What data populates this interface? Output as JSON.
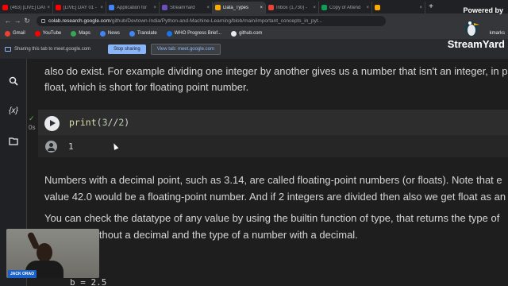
{
  "browser": {
    "tabs": [
      {
        "title": "(463) [LIVE] DAY",
        "color": "#ff0000",
        "active": false
      },
      {
        "title": "[LIVE] DAY 01 -",
        "color": "#ff0000",
        "active": false
      },
      {
        "title": "Application for",
        "color": "#4285f4",
        "active": false
      },
      {
        "title": "StreamYard",
        "color": "#6b4fbb",
        "active": false
      },
      {
        "title": "Data_Types",
        "color": "#f9ab00",
        "active": true
      },
      {
        "title": "Inbox (1,730) -",
        "color": "#ea4335",
        "active": false
      },
      {
        "title": "Copy of Attend",
        "color": "#0f9d58",
        "active": false
      },
      {
        "title": "",
        "color": "#f9ab00",
        "active": false
      }
    ],
    "new_tab": "+",
    "address": {
      "host": "colab.research.google.com",
      "path": "/github/Devtown-India/Python-and-Machine-Learning/blob/main/important_concepts_in_pyt..."
    },
    "bookmarks": [
      {
        "label": "Gmail",
        "color": "#ea4335"
      },
      {
        "label": "YouTube",
        "color": "#ff0000"
      },
      {
        "label": "Maps",
        "color": "#34a853"
      },
      {
        "label": "News",
        "color": "#4285f4"
      },
      {
        "label": "Translate",
        "color": "#4285f4"
      },
      {
        "label": "WHO Progress Brief...",
        "color": "#1a73e8"
      },
      {
        "label": "github.com",
        "color": "#e8eaed"
      }
    ],
    "bookmarks_right": "kmarks"
  },
  "sharing": {
    "text": "Sharing this tab to meet.google.com",
    "stop_label": "Stop sharing",
    "view_label": "View tab: meet.google.com"
  },
  "rail": {
    "icons": [
      "search-icon",
      "variables-icon",
      "folder-icon"
    ],
    "variables_glyph": "{x}"
  },
  "notebook": {
    "para1_line1": "also do exist. For example dividing one integer by another gives us a number that isn't an integer, in p",
    "para1_line2": "float, which is short for floating point number.",
    "cell": {
      "status_check": "✓",
      "exec_time": "0s",
      "code_fn": "print",
      "code_open": "(",
      "code_num1": "3",
      "code_op": "//",
      "code_num2": "2",
      "code_close": ")",
      "output": "1"
    },
    "para2_line1": "Numbers with a decimal point, such as 3.14, are called floating-point numbers (or floats). Note that e",
    "para2_line2": "value 42.0 would be a floating-point number. And if 2 integers are divided then also we get float as an",
    "para3_line1": "You can check the datatype of any value by using the builtin function of type, that returns the type of",
    "para3_line2": "ithout a decimal and the type of a number with a decimal.",
    "next_code": "b = 2.5"
  },
  "webcam": {
    "name": "JACK ORAO"
  },
  "streamyard": {
    "powered_by": "Powered by",
    "brand": "StreamYard"
  }
}
